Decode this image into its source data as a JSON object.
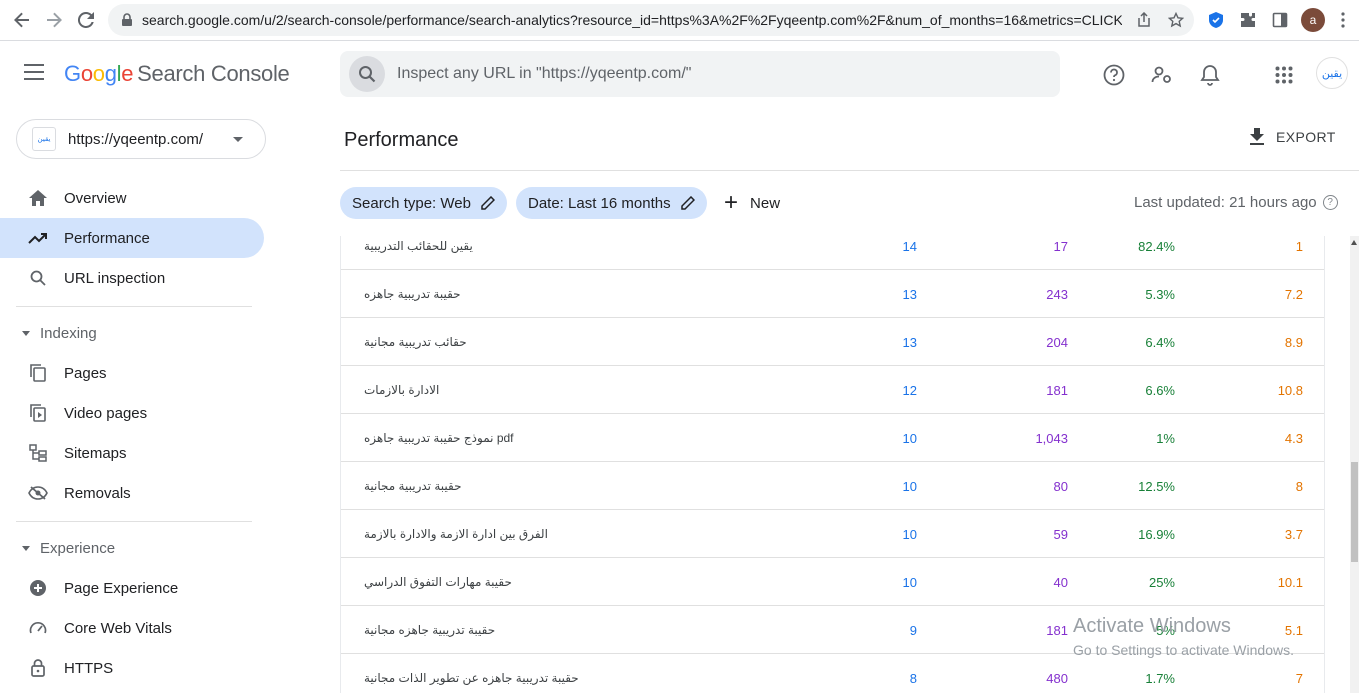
{
  "browser": {
    "url": "search.google.com/u/2/search-console/performance/search-analytics?resource_id=https%3A%2F%2Fyqeentp.com%2F&num_of_months=16&metrics=CLICK...",
    "profile_initial": "a"
  },
  "app": {
    "logo_google": [
      "G",
      "o",
      "o",
      "g",
      "l",
      "e"
    ],
    "logo_rest": "Search Console",
    "inspect_placeholder": "Inspect any URL in \"https://yqeentp.com/\"",
    "site_avatar_text": "يقين"
  },
  "sidebar": {
    "property": "https://yqeentp.com/",
    "property_favicon": "يقين",
    "items": [
      {
        "label": "Overview",
        "icon": "home-icon",
        "active": false
      },
      {
        "label": "Performance",
        "icon": "trending-up-icon",
        "active": true
      },
      {
        "label": "URL inspection",
        "icon": "search-icon",
        "active": false
      }
    ],
    "indexing_header": "Indexing",
    "indexing_items": [
      {
        "label": "Pages",
        "icon": "pages-icon"
      },
      {
        "label": "Video pages",
        "icon": "video-pages-icon"
      },
      {
        "label": "Sitemaps",
        "icon": "sitemap-icon"
      },
      {
        "label": "Removals",
        "icon": "removals-icon"
      }
    ],
    "experience_header": "Experience",
    "experience_items": [
      {
        "label": "Page Experience",
        "icon": "page-experience-icon"
      },
      {
        "label": "Core Web Vitals",
        "icon": "gauge-icon"
      },
      {
        "label": "HTTPS",
        "icon": "lock-icon"
      }
    ]
  },
  "main": {
    "title": "Performance",
    "export_label": "EXPORT",
    "chip_search_type": "Search type: Web",
    "chip_date": "Date: Last 16 months",
    "new_label": "New",
    "last_updated": "Last updated: 21 hours ago",
    "rows": [
      {
        "query": "يقين للحقائب التدريبية",
        "clicks": "14",
        "impressions": "17",
        "ctr": "82.4%",
        "position": "1"
      },
      {
        "query": "حقيبة تدريبية جاهزه",
        "clicks": "13",
        "impressions": "243",
        "ctr": "5.3%",
        "position": "7.2"
      },
      {
        "query": "حقائب تدريبية مجانية",
        "clicks": "13",
        "impressions": "204",
        "ctr": "6.4%",
        "position": "8.9"
      },
      {
        "query": "الادارة بالازمات",
        "clicks": "12",
        "impressions": "181",
        "ctr": "6.6%",
        "position": "10.8"
      },
      {
        "query": "نموذج حقيبة تدريبية جاهزه pdf",
        "clicks": "10",
        "impressions": "1,043",
        "ctr": "1%",
        "position": "4.3"
      },
      {
        "query": "حقيبة تدريبية مجانية",
        "clicks": "10",
        "impressions": "80",
        "ctr": "12.5%",
        "position": "8"
      },
      {
        "query": "الفرق بين ادارة الازمة والادارة بالازمة",
        "clicks": "10",
        "impressions": "59",
        "ctr": "16.9%",
        "position": "3.7"
      },
      {
        "query": "حقيبة مهارات التفوق الدراسي",
        "clicks": "10",
        "impressions": "40",
        "ctr": "25%",
        "position": "10.1"
      },
      {
        "query": "حقيبة تدريبية جاهزه مجانية",
        "clicks": "9",
        "impressions": "181",
        "ctr": "5%",
        "position": "5.1"
      },
      {
        "query": "حقيبة تدريبية جاهزه عن تطوير الذات مجانية",
        "clicks": "8",
        "impressions": "480",
        "ctr": "1.7%",
        "position": "7"
      }
    ]
  },
  "watermark": {
    "line1": "Activate Windows",
    "line2": "Go to Settings to activate Windows."
  }
}
